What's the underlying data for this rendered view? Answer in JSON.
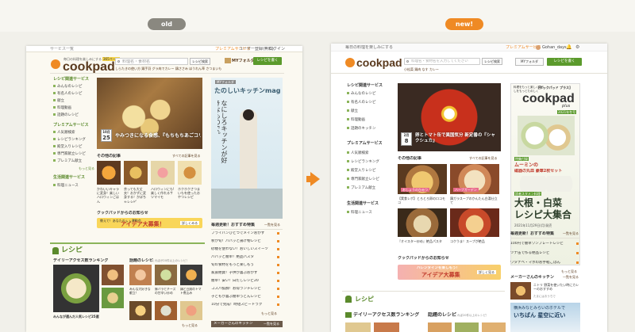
{
  "labels": {
    "old": "old",
    "new": "new!"
  },
  "old": {
    "topbar": {
      "services": "サービス一覧",
      "premium": "プレミアムサービス",
      "user_register": "ユーザー登録(無料)",
      "login": "ログイン"
    },
    "logo": {
      "tagline": "毎日の料理を楽しみにする",
      "name": "cookpad",
      "badge": "365ページ"
    },
    "search": {
      "placeholder": "料理名・食材名",
      "button": "レシピ検索",
      "my_folder": "MYフォルダ",
      "post_button": "レシピを書く"
    },
    "hotwords": "しらたきの使い方 鶏手羽 グラ肉でカレー 鶏ささみ ほうれん草 さつまいも",
    "sidebar": {
      "recipe_heading": "レシピ関連サービス",
      "recipe_items": [
        "みんなのレシピ",
        "有名人のレシピ",
        "献立",
        "料理動画",
        "話題のレシピ"
      ],
      "premium_heading": "プレミアムサービス",
      "premium_items": [
        "人気順検索",
        "レシピランキング",
        "殿堂入りレシピ",
        "専門家献立レシピ",
        "プレミアム献立"
      ],
      "more1": "もっと見る",
      "life_heading": "生活関連サービス",
      "life_items": [
        "料理ニュース"
      ]
    },
    "hero": {
      "date_month": "10月",
      "date_day": "25",
      "caption": "やみつきになる食感、『もちもちあごコリコリ』"
    },
    "mag": {
      "label": "MYフォルダ",
      "title": "たのしいキッチンmag",
      "vertical_text": "なにしろキッチンが好きなもので。"
    },
    "articles": {
      "heading": "その他の記事",
      "more": "すべての記事を見る",
      "items": [
        "かわいいキャラに変身！楽しいハロウィンごはん",
        "余っても大丈夫！おかずに変身する！かぼちゃレシピ",
        "ハロウィンにも!楽しく作れるサツマイモ",
        "ホクホクさつまいもを使ったおやつレシピ"
      ]
    },
    "kitchen_note": "クックパッドからのお知らせ",
    "banner": {
      "text": "教えて！あなたのㇺㇺ運動会",
      "title": "アイデア大募集！",
      "button": "詳しくみる"
    },
    "daily": {
      "heading": "毎週更新！おすすめ特集",
      "more": "一覧を見る",
      "items": [
        "フライパンひとつでメインおかず",
        "秋が旬！パパッと揚げ物レシピ",
        "砂糖を使わない！おいしいスイーツ",
        "パパッと簡単！絶品パスタ",
        "旬の食材をもっと楽しもう",
        "家族絶賛！子供が喜ぶおかず",
        "簡単！安い！白だしレシピ20",
        "コスパ抜群！お得ランチレシピ",
        "子どもが喜ぶ簡単うどんレシピ",
        "10分で完成！時短スピードラク"
      ],
      "more2": "もっと見る"
    },
    "recipe_section": {
      "heading": "レシピ",
      "ranking": "デイリーアクセス数ランキング",
      "topic": "話題のレシピ",
      "topic_note": "つくれぽが20件以上のレシピ！",
      "items": [
        "みんな大好きな献立！",
        "豚バラとチーズの甘辛い炒め",
        "鶏と豆腐のトマト煮込み",
        "まるごとかぼちゃのキッシュ"
      ],
      "footer": "みんなが選んだ人気レシピ25選",
      "more": "もっと見る"
    },
    "bottom_banner": {
      "heading": "メーカーさんのキッチン",
      "more": "一覧を見る"
    }
  },
  "new": {
    "topbar": {
      "tagline": "毎日の料理を楽しみにする",
      "premium": "プレミアムサービス",
      "user": "Gohan_days"
    },
    "logo": {
      "name": "cookpad"
    },
    "search": {
      "placeholder": "料理名・食材名を入力してください",
      "button": "レシピ検索",
      "my_folder": "MYフォルダ",
      "post_button": "レシピを書く"
    },
    "hotwords": "小松菜 鶏肉 なす カレー",
    "sidebar": {
      "recipe_heading": "レシピ関連サービス",
      "recipe_items": [
        "みんなのレシピ",
        "有名人のレシピ",
        "献立",
        "料理動画",
        "話題のキッチン"
      ],
      "premium_heading": "プレミアムサービス",
      "premium_items": [
        "人気順検索",
        "レシピランキング",
        "殿堂入りレシピ",
        "専門家献立レシピ",
        "プレミアム献立"
      ],
      "life_heading": "生活関連サービス",
      "life_items": [
        "料理ニュース"
      ]
    },
    "hero": {
      "date_month": "2月",
      "date_day": "8",
      "caption": "卵とトマト缶で異国気分 新定番の『シャクシュカ』"
    },
    "ad": {
      "top_note": "料理をもっと楽しく暮らしをもっとたのしく",
      "brand_tag": "[クックパッド プラス]",
      "name": "cookpad",
      "plus": "plus",
      "issue": "2021年冬号",
      "title_line1": "大根・白菜",
      "title_line2": "レシピ大集合",
      "note1": "特集付録",
      "note2": "ムーミンの",
      "note3": "磁器の丸皿 豪華2枚セット",
      "release": "2021年11月29日(月)発売",
      "sub_note": "読者スタメン料理"
    },
    "articles": {
      "heading": "その他の記事",
      "more": "すべての記事を見る",
      "items": [
        "【実食レポ】とろとろ卵のロコモコ",
        "鶏ガラスープのかんたん白湯仕立て",
        "『オイスター炒め』絶品パスタ",
        "コクうま！スープが絶品"
      ]
    },
    "article_chips": [
      "おしょうのひみつ",
      "ハーブガーデン"
    ],
    "kitchen_note": "クックパッドからのお知らせ",
    "banner": {
      "text": "バレンタインを楽しもう！",
      "title": "アイデア大募集",
      "button": "詳しく見る"
    },
    "daily": {
      "heading": "毎週更新！おすすめ特集",
      "more": "一覧を見る",
      "items": [
        "100円で簡単ワンプレートレシピ",
        "ツナ缶で作る絶品レシピ",
        "ワタナベ・マホのお手軽ごはん"
      ],
      "more2": "もっと見る"
    },
    "maker": {
      "heading": "メーカーさんのキッチン",
      "more": "一覧を見る",
      "item": "ニトリ 野菜を使いたい時にカレーのおすすめ",
      "item_sub": "たまにはおうちで",
      "bottom_ad1": "横浜みなとみらいのホテルで",
      "bottom_ad2": "いちばん 星空に近い"
    },
    "recipe_section": {
      "heading": "レシピ",
      "ranking": "デイリーアクセス数ランキング",
      "topic": "話題のレシピ",
      "topic_note": "つくれぽ20件以上のレシピ！"
    }
  }
}
